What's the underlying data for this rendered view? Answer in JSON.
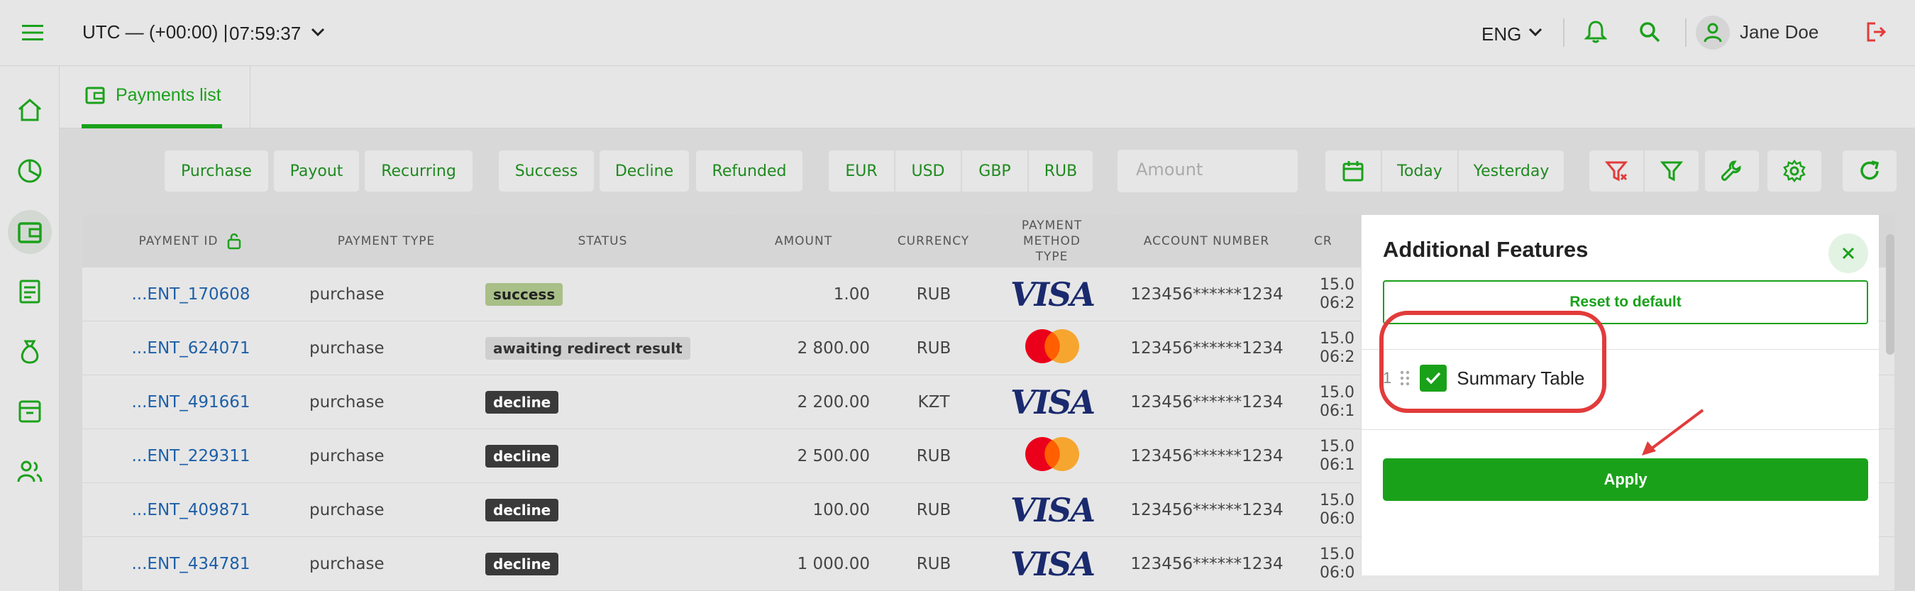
{
  "header": {
    "timezone": "UTC — (+00:00) |",
    "time": "07:59:37",
    "language": "ENG",
    "user_name": "Jane Doe"
  },
  "tab": {
    "label": "Payments list"
  },
  "filters": {
    "type": [
      "Purchase",
      "Payout",
      "Recurring"
    ],
    "status": [
      "Success",
      "Decline",
      "Refunded"
    ],
    "currency": [
      "EUR",
      "USD",
      "GBP",
      "RUB"
    ],
    "amount_placeholder": "Amount",
    "dates": [
      "Today",
      "Yesterday"
    ]
  },
  "table": {
    "columns": [
      "PAYMENT ID",
      "PAYMENT TYPE",
      "STATUS",
      "AMOUNT",
      "CURRENCY",
      "PAYMENT METHOD TYPE",
      "ACCOUNT NUMBER",
      "CR"
    ],
    "rows": [
      {
        "id": "...ENT_170608",
        "type": "purchase",
        "status": "success",
        "amount": "1.00",
        "currency": "RUB",
        "method": "VISA",
        "account": "123456******1234",
        "created": "15.0",
        "created2": "06:2"
      },
      {
        "id": "...ENT_624071",
        "type": "purchase",
        "status": "awaiting redirect result",
        "amount": "2 800.00",
        "currency": "RUB",
        "method": "mastercard",
        "account": "123456******1234",
        "created": "15.0",
        "created2": "06:2"
      },
      {
        "id": "...ENT_491661",
        "type": "purchase",
        "status": "decline",
        "amount": "2 200.00",
        "currency": "KZT",
        "method": "VISA",
        "account": "123456******1234",
        "created": "15.0",
        "created2": "06:1"
      },
      {
        "id": "...ENT_229311",
        "type": "purchase",
        "status": "decline",
        "amount": "2 500.00",
        "currency": "RUB",
        "method": "mastercard",
        "account": "123456******1234",
        "created": "15.0",
        "created2": "06:1"
      },
      {
        "id": "...ENT_409871",
        "type": "purchase",
        "status": "decline",
        "amount": "100.00",
        "currency": "RUB",
        "method": "VISA",
        "account": "123456******1234",
        "created": "15.0",
        "created2": "06:0"
      },
      {
        "id": "...ENT_434781",
        "type": "purchase",
        "status": "decline",
        "amount": "1 000.00",
        "currency": "RUB",
        "method": "VISA",
        "account": "123456******1234",
        "created": "15.0",
        "created2": "06:0"
      }
    ]
  },
  "panel": {
    "title": "Additional Features",
    "reset_label": "Reset to default",
    "features": [
      {
        "index": "1",
        "label": "Summary Table",
        "checked": true
      }
    ],
    "apply_label": "Apply"
  },
  "colors": {
    "accent": "#1aa11a",
    "link": "#1d5fa8",
    "highlight": "#e23b3b"
  }
}
